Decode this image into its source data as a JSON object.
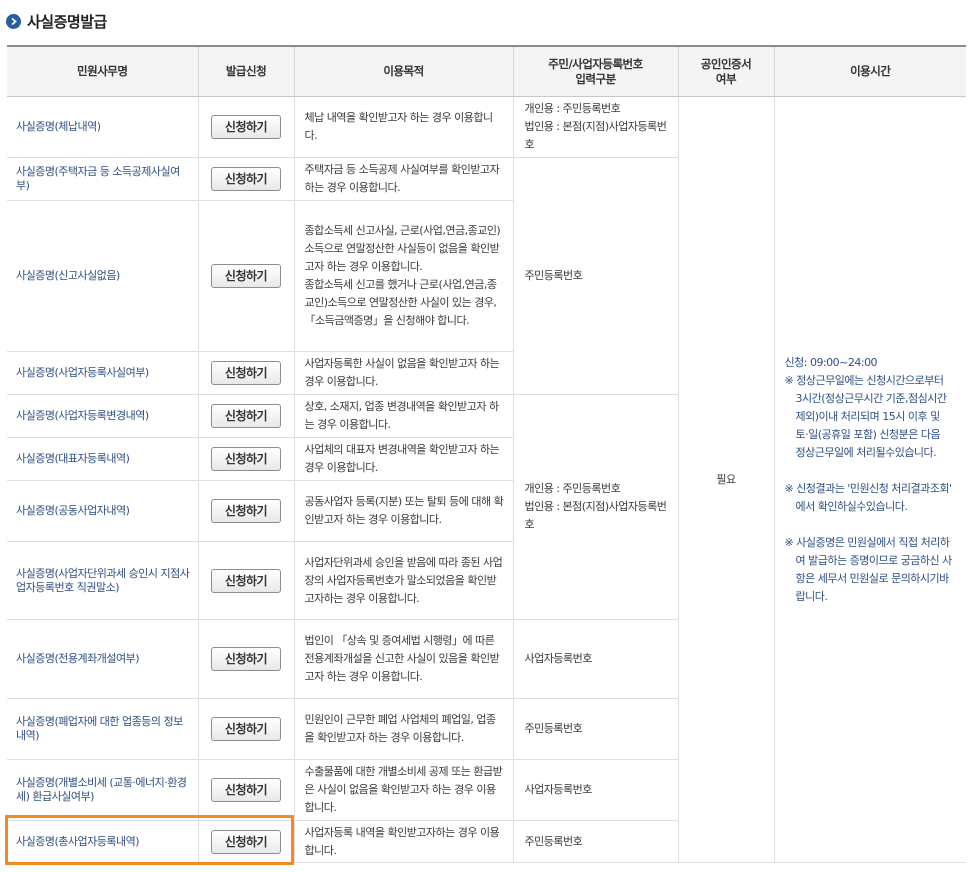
{
  "heading": {
    "title": "사실증명발급",
    "bullet_icon": "circle-arrow-right-icon"
  },
  "columns": [
    "민원사무명",
    "발급신청",
    "이용목적",
    "주민/사업자등록번호\n입력구분",
    "공인인증서\n여부",
    "이용시간"
  ],
  "rows": [
    {
      "name": "사실증명(체납내역)",
      "button": "신청하기",
      "purpose": "체납 내역을 확인받고자 하는 경우 이용합니다."
    },
    {
      "name": "사실증명(주택자금 등 소득공제사실여부)",
      "button": "신청하기",
      "purpose": "주택자금 등 소득공제 사실여부를 확인받고자 하는 경우 이용합니다."
    },
    {
      "name": "사실증명(신고사실없음)",
      "button": "신청하기",
      "purpose": "종합소득세 신고사실, 근로(사업,연금,종교인)소득으로 연말정산한 사실등이 없음을 확인받고자 하는 경우 이용합니다.\n종합소득세 신고를 했거나 근로(사업,연금,종교인)소득으로 연말정산한 사실이 있는 경우, 「소득금액증명」을 신청해야 합니다."
    },
    {
      "name": "사실증명(사업자등록사실여부)",
      "button": "신청하기",
      "purpose": "사업자등록한 사실이 없음을 확인받고자 하는 경우 이용합니다."
    },
    {
      "name": "사실증명(사업자등록변경내역)",
      "button": "신청하기",
      "purpose": "상호, 소재지, 업종 변경내역을 확인받고자 하는 경우 이용합니다."
    },
    {
      "name": "사실증명(대표자등록내역)",
      "button": "신청하기",
      "purpose": "사업체의 대표자 변경내역을 확인받고자 하는 경우 이용합니다."
    },
    {
      "name": "사실증명(공동사업자내역)",
      "button": "신청하기",
      "purpose": "공동사업자 등록(지분) 또는 탈퇴 등에 대해 확인받고자 하는 경우 이용합니다."
    },
    {
      "name": "사실증명(사업자단위과세 승인시 지점사업자등록번호 직권말소)",
      "button": "신청하기",
      "purpose": "사업자단위과세 승인을 받음에 따라 종된 사업장의 사업자등록번호가 말소되었음을 확인받고자하는 경우 이용합니다."
    },
    {
      "name": "사실증명(전용계좌개설여부)",
      "button": "신청하기",
      "purpose": "법인이 「상속 및 증여세법 시행령」에 따른 전용계좌개설을 신고한 사실이 있음을 확인받고자 하는 경우 이용합니다."
    },
    {
      "name": "사실증명(폐업자에 대한 업종등의 정보내역)",
      "button": "신청하기",
      "purpose": "민원인이 근무한 폐업 사업체의 폐업일, 업종을 확인받고자 하는 경우 이용합니다."
    },
    {
      "name": "사실증명(개별소비세 (교통·에너지·환경세) 환급사실여부)",
      "button": "신청하기",
      "purpose": "수출물품에 대한 개별소비세 공제 또는 환급받은 사실이 없음을 확인받고자 하는 경우 이용합니다."
    },
    {
      "name": "사실증명(총사업자등록내역)",
      "button": "신청하기",
      "purpose": "사업자등록 내역을 확인받고자하는 경우 이용합니다."
    }
  ],
  "id_types": {
    "group1": "개인용 : 주민등록번호\n법인용 : 본점(지점)사업자등록번호",
    "group2": "주민등록번호",
    "group3": "개인용 : 주민등록번호\n법인용 : 본점(지점)사업자등록번호",
    "group4": "사업자등록번호",
    "group5": "주민등록번호",
    "group6": "사업자등록번호",
    "group7": "주민등록번호"
  },
  "cert_required": "필요",
  "hours": {
    "apply": "신청: 09:00~24:00",
    "note1": "※ 정상근무일에는 신청시간으로부터 3시간(정상근무시간 기준,점심시간 제외)이내 처리되며 15시 이후 및 토·일(공휴일 포함) 신청분은 다음 정상근무일에 처리될수있습니다.",
    "note2": "※ 신청결과는 '민원신청 처리결과조회' 에서 확인하실수있습니다.",
    "note3": "※ 사실증명은 민원실에서 직접 처리하여 발급하는 증명이므로 궁금하신 사항은 세무서 민원실로 문의하시기바랍니다."
  },
  "colors": {
    "accent": "#2a5d9f",
    "highlight": "#f28a26",
    "link": "#2f4f82"
  }
}
